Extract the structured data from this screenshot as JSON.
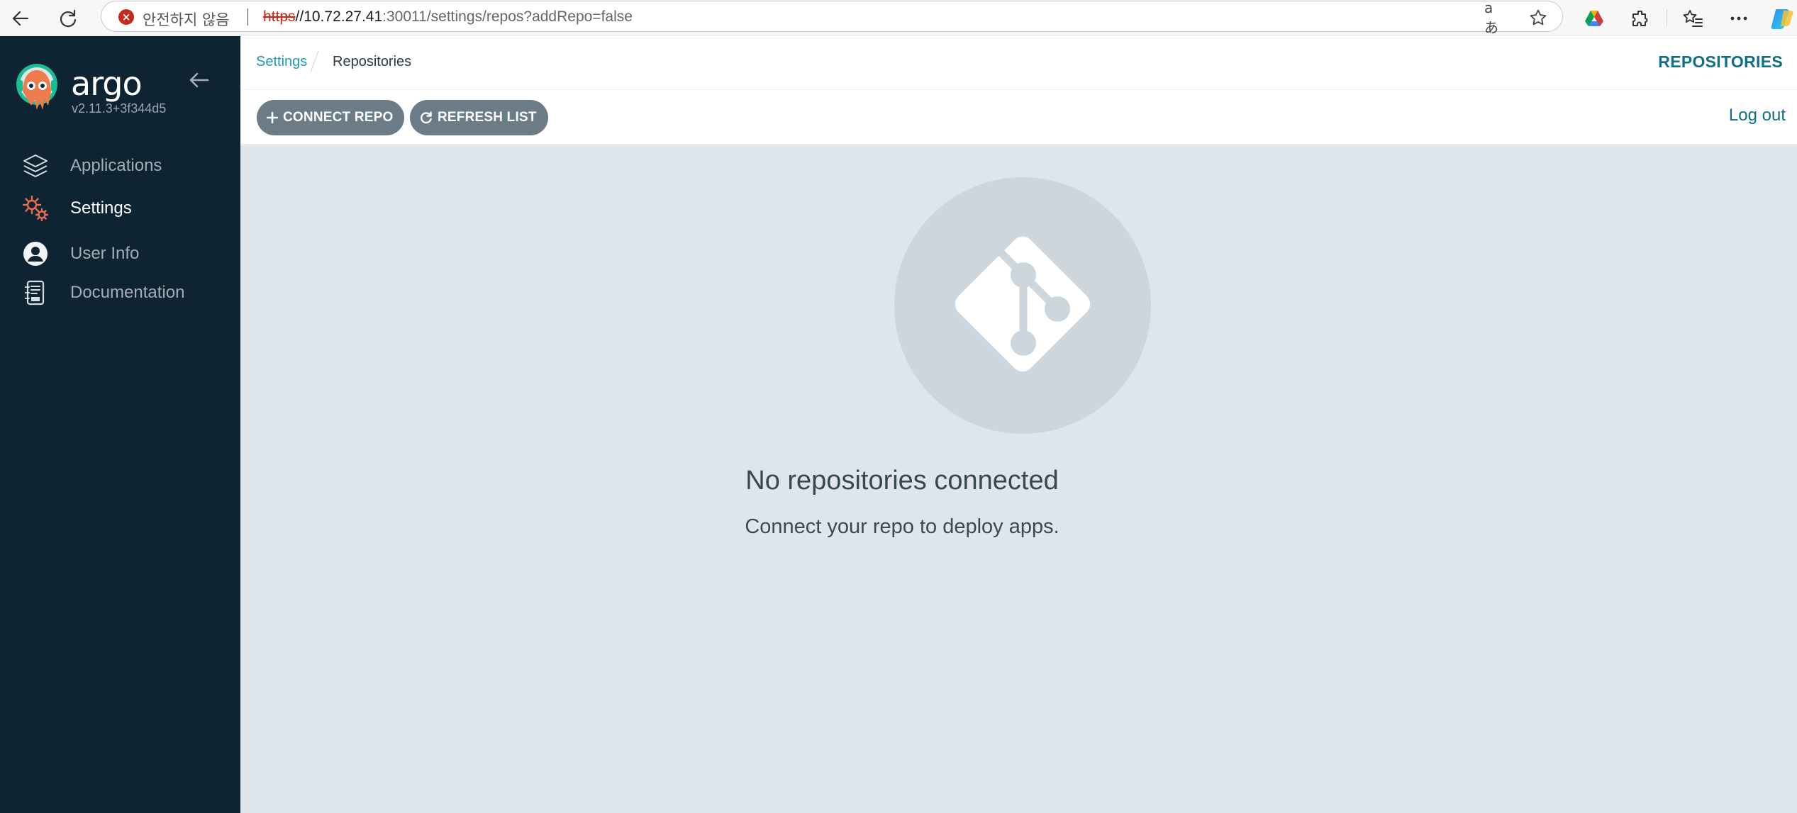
{
  "browser": {
    "security_label": "안전하지 않음",
    "url_scheme": "https",
    "url_host": "//10.72.27.41",
    "url_rest": ":30011/settings/repos?addRepo=false",
    "read_aloud_label": "aあ",
    "icons": [
      "back-icon",
      "refresh-icon",
      "warning-icon",
      "read-aloud-icon",
      "favorite-star-icon",
      "drive-icon",
      "extensions-icon",
      "favorites-icon",
      "more-icon",
      "copilot-icon"
    ]
  },
  "sidebar": {
    "brand": "argo",
    "version": "v2.11.3+3f344d5",
    "items": [
      {
        "label": "Applications",
        "icon": "layers-icon",
        "active": false
      },
      {
        "label": "Settings",
        "icon": "gears-icon",
        "active": true
      },
      {
        "label": "User Info",
        "icon": "user-circle-icon",
        "active": false
      },
      {
        "label": "Documentation",
        "icon": "book-icon",
        "active": false
      }
    ]
  },
  "header": {
    "breadcrumb_link": "Settings",
    "breadcrumb_current": "Repositories",
    "page_title": "REPOSITORIES"
  },
  "toolbar": {
    "connect_label": "CONNECT REPO",
    "refresh_label": "REFRESH LIST",
    "logout_label": "Log out"
  },
  "empty_state": {
    "title": "No repositories connected",
    "subtitle": "Connect your repo to deploy apps.",
    "icon": "git-icon"
  },
  "colors": {
    "sidebar_bg": "#0f2432",
    "content_bg": "#dee6eb",
    "accent": "#0f6f85",
    "link": "#1f9bb8",
    "button_bg": "#6c7c87",
    "active_icon": "#e96d4e"
  }
}
